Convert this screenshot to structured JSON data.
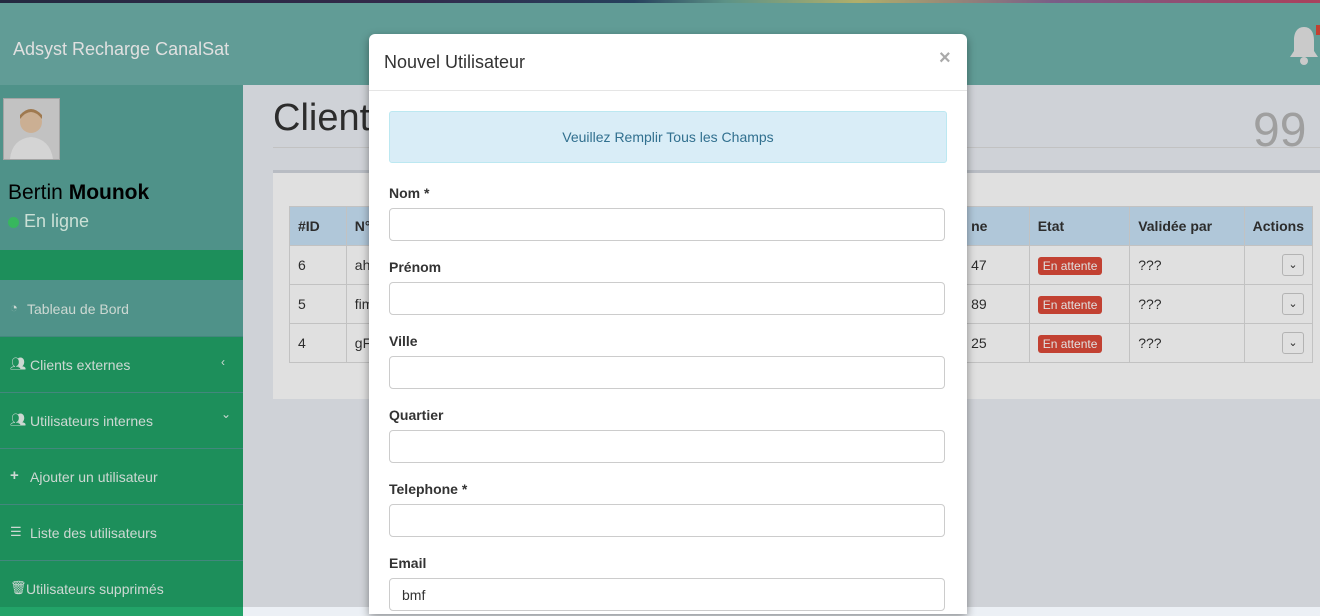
{
  "header": {
    "brand": "Adsyst Recharge CanalSat"
  },
  "sidebar": {
    "user_first": "Bertin",
    "user_last": "Mounok",
    "status": "En ligne",
    "items": [
      {
        "label": "Tableau de Bord",
        "icon": "dashboard-icon"
      },
      {
        "label": "Clients externes",
        "icon": "users-icon",
        "chevron": "‹"
      },
      {
        "label": "Utilisateurs internes",
        "icon": "users-icon",
        "chevron": "⌄"
      },
      {
        "label": "Ajouter un utilisateur",
        "icon": "plus-icon"
      },
      {
        "label": "Liste des utilisateurs",
        "icon": "list-icon"
      },
      {
        "label": "Utilisateurs supprimés",
        "icon": "trash-icon"
      }
    ]
  },
  "main": {
    "title": "Clients",
    "stat": "99",
    "table": {
      "headers": [
        "#ID",
        "N°T",
        "ne",
        "Etat",
        "Validée par",
        "Actions"
      ],
      "rows": [
        {
          "id": "6",
          "num": "ahjp",
          "phone": "47",
          "etat": "En attente",
          "validee": "???"
        },
        {
          "id": "5",
          "num": "fimu",
          "phone": "89",
          "etat": "En attente",
          "validee": "???"
        },
        {
          "id": "4",
          "num": "gFH",
          "phone": "25",
          "etat": "En attente",
          "validee": "???"
        }
      ]
    }
  },
  "modal": {
    "title": "Nouvel Utilisateur",
    "close": "×",
    "alert": "Veuillez Remplir Tous les Champs",
    "fields": [
      {
        "label": "Nom *",
        "value": ""
      },
      {
        "label": "Prénom",
        "value": ""
      },
      {
        "label": "Ville",
        "value": ""
      },
      {
        "label": "Quartier",
        "value": ""
      },
      {
        "label": "Telephone *",
        "value": ""
      },
      {
        "label": "Email",
        "value": "bmf"
      }
    ]
  },
  "colors": {
    "header": "#6fb2ab",
    "sidebar": "#5aa79c",
    "menu_active": "#22a368",
    "badge": "#dd4b39"
  }
}
